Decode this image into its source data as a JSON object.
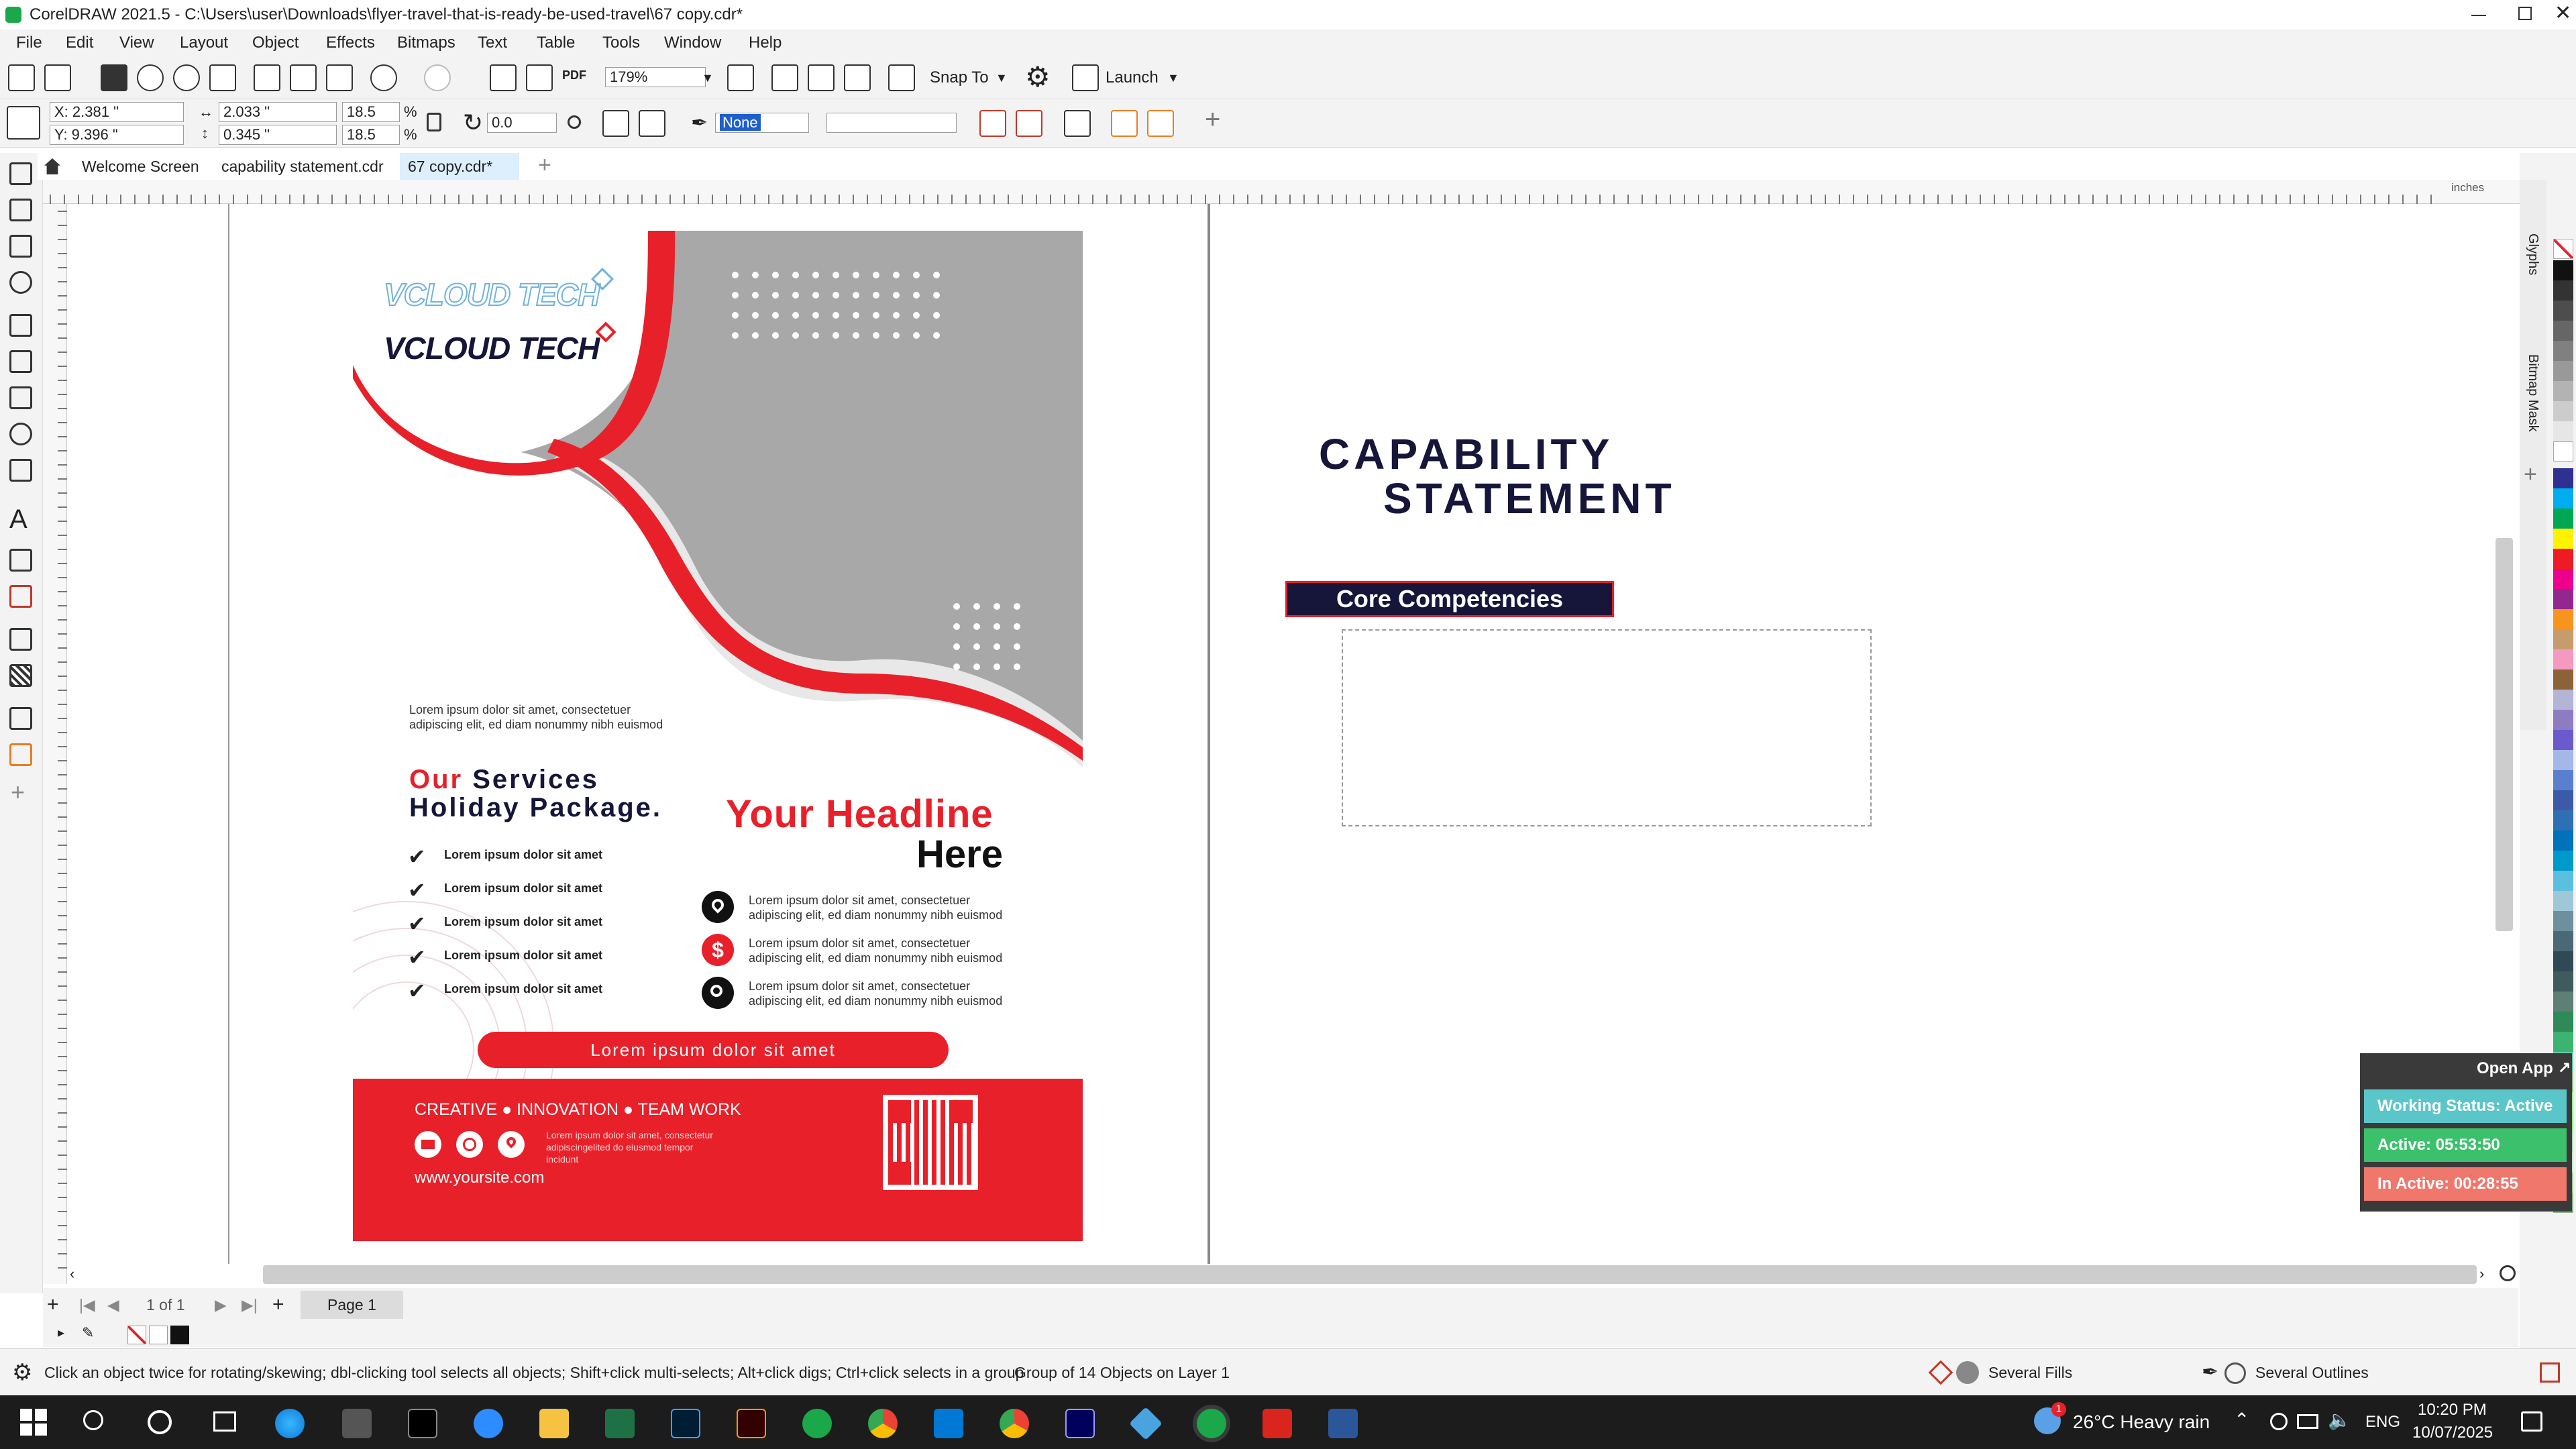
{
  "window": {
    "title": "CorelDRAW 2021.5 - C:\\Users\\user\\Downloads\\flyer-travel-that-is-ready-be-used-travel\\67 copy.cdr*",
    "controls": [
      "minimize-icon",
      "maximize-icon",
      "close-icon"
    ]
  },
  "menu": [
    "File",
    "Edit",
    "View",
    "Layout",
    "Object",
    "Effects",
    "Bitmaps",
    "Text",
    "Table",
    "Tools",
    "Window",
    "Help"
  ],
  "toolbar": {
    "zoom": "179%",
    "snap_to": "Snap To",
    "launch": "Launch"
  },
  "propbar": {
    "x": "X: 2.381 \"",
    "y": "Y: 9.396 \"",
    "width": "2.033 \"",
    "height": "0.345 \"",
    "scale_w": "18.5",
    "scale_h": "18.5",
    "pct1": "%",
    "pct2": "%",
    "rotation": "0.0",
    "outline_width": "None"
  },
  "tabs": [
    "Welcome Screen",
    "capability statement.cdr",
    "67 copy.cdr*"
  ],
  "ruler": {
    "unit": "inches"
  },
  "flyer": {
    "logo_outline": "VCLOUD TECH",
    "logo_solid": "VCLOUD TECH",
    "lorem_top_1": "Lorem ipsum dolor sit amet, consectetuer",
    "lorem_top_2": "adipiscing elit, ed diam nonummy nibh euismod",
    "services_our": "Our",
    "services_rest": " Services",
    "holiday": "Holiday Package.",
    "checklist": [
      "Lorem ipsum dolor sit amet",
      "Lorem ipsum dolor sit amet",
      "Lorem ipsum dolor sit amet",
      "Lorem ipsum dolor sit amet",
      "Lorem ipsum dolor sit amet"
    ],
    "headline_1": "Your Headline",
    "headline_2": "Here",
    "features": [
      {
        "icon": "location-pin-icon",
        "line1": "Lorem ipsum dolor sit amet, consectetuer",
        "line2": "adipiscing elit, ed diam nonummy nibh euismod"
      },
      {
        "icon": "dollar-icon",
        "line1": "Lorem ipsum dolor sit amet, consectetuer",
        "line2": "adipiscing elit, ed diam nonummy nibh euismod"
      },
      {
        "icon": "search-icon",
        "line1": "Lorem ipsum dolor sit amet, consectetuer",
        "line2": "adipiscing elit, ed diam nonummy nibh euismod"
      }
    ],
    "cta": "Lorem ipsum dolor sit amet",
    "footer_values": "CREATIVE ● INNOVATION ● TEAM WORK",
    "footer_small_1": "Lorem ipsum dolor sit amet, consectetur",
    "footer_small_2": "adipiscingelited do eiusmod tempor",
    "footer_small_3": "incidunt",
    "website": "www.yoursite.com",
    "colors": {
      "red": "#e8202a",
      "gray": "#a8a8a8",
      "dark": "#1b1b2f"
    }
  },
  "capability": {
    "title_1": "CAPABILITY",
    "title_2": "STATEMENT",
    "core": "Core Competencies"
  },
  "page_nav": {
    "count": "1 of 1",
    "page": "Page 1"
  },
  "status": {
    "hint": "Click an object twice for rotating/skewing; dbl-clicking tool selects all objects; Shift+click multi-selects; Alt+click digs; Ctrl+click selects in a group",
    "selection": "Group of 14 Objects on Layer 1",
    "fills": "Several Fills",
    "outlines": "Several Outlines"
  },
  "widget": {
    "open_app": "Open App ↗",
    "working": "Working Status: Active",
    "active": "Active: 05:53:50",
    "inactive": "In Active: 00:28:55"
  },
  "dock": {
    "glyphs": "Glyphs",
    "bitmap_mask": "Bitmap Mask"
  },
  "taskbar": {
    "weather": "26°C  Heavy rain",
    "lang": "ENG",
    "time": "10:20 PM",
    "date": "10/07/2025",
    "notif": "1"
  }
}
